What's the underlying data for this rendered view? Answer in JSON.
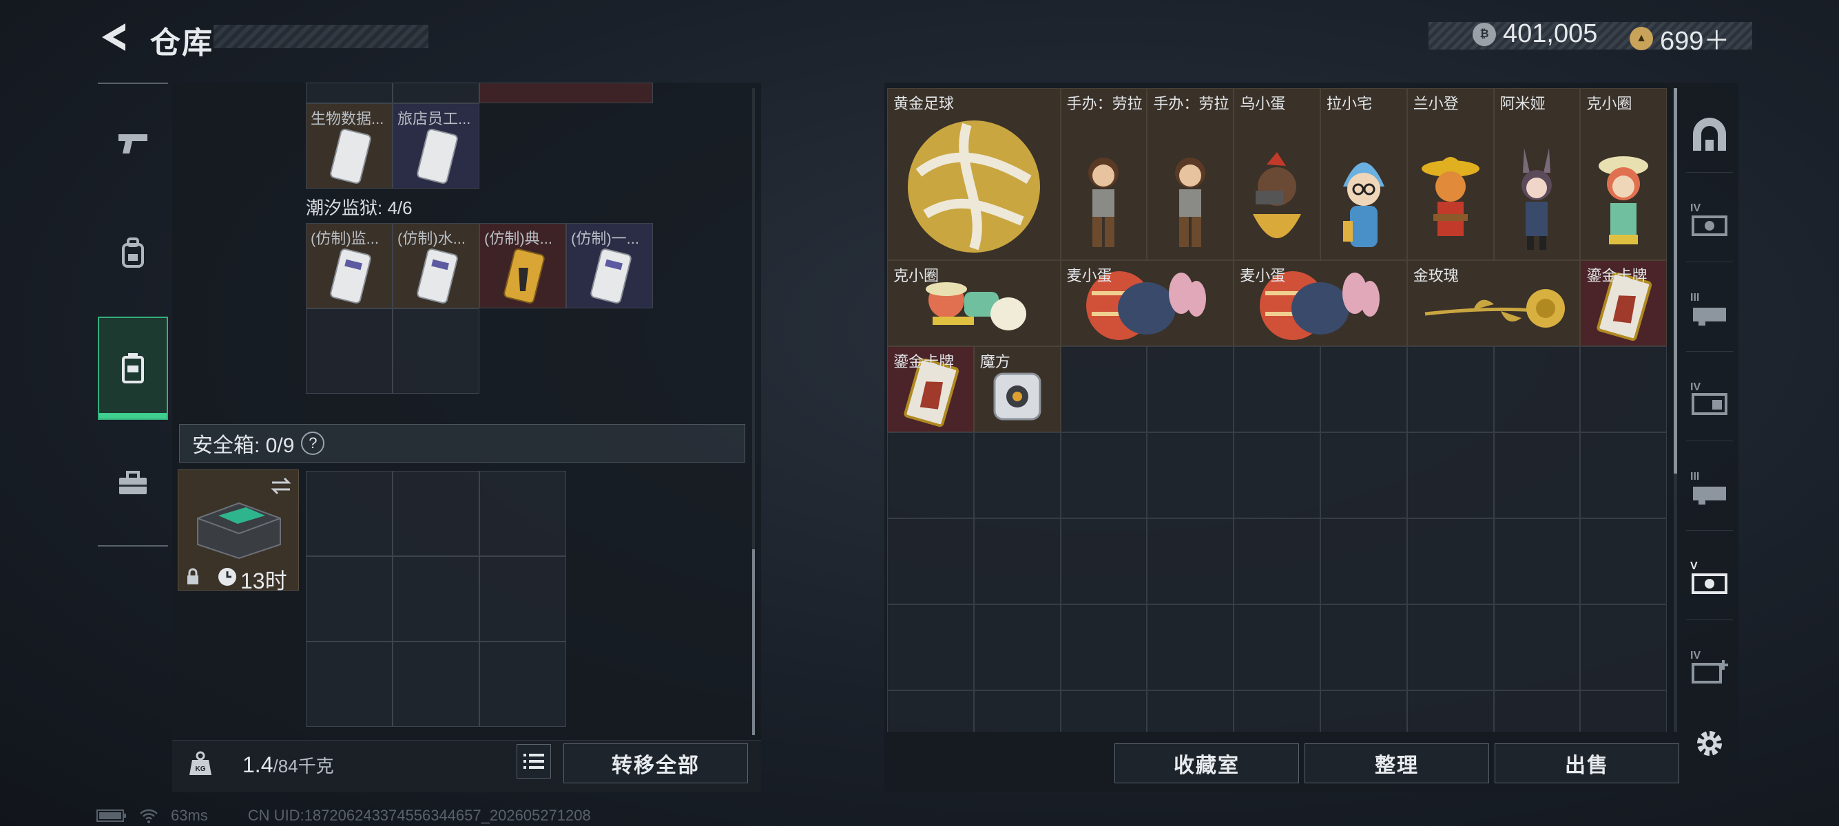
{
  "header": {
    "title": "仓库"
  },
  "currency": [
    {
      "icon": "silver-coin-icon",
      "value": "401,005"
    },
    {
      "icon": "gold-triangle-coin-icon",
      "value": "699＋"
    }
  ],
  "left_nav": [
    {
      "name": "pistol-icon"
    },
    {
      "name": "backpack-icon"
    },
    {
      "name": "chest-rig-icon",
      "active": true
    },
    {
      "name": "toolbox-icon"
    }
  ],
  "left_panel": {
    "items_top": [
      {
        "label": "生物数据...",
        "tag": "brown"
      },
      {
        "label": "旅店员工...",
        "tag": "blue"
      }
    ],
    "section": "潮汐监狱: 4/6",
    "prison_items": [
      {
        "label": "(仿制)监...",
        "tag": "brown"
      },
      {
        "label": "(仿制)水...",
        "tag": "brown"
      },
      {
        "label": "(仿制)典...",
        "tag": "red"
      },
      {
        "label": "(仿制)一...",
        "tag": "blue"
      }
    ],
    "safebox": {
      "label": "安全箱: 0/9",
      "help": "?",
      "timer": "13时"
    }
  },
  "weight": {
    "current": "1.4",
    "max": "/84千克"
  },
  "left_buttons": {
    "transfer_all": "转移全部"
  },
  "storage_items": [
    {
      "label": "黄金足球",
      "kind": "ball"
    },
    {
      "label": "手办：劳拉",
      "kind": "figure-lara"
    },
    {
      "label": "手办：劳拉",
      "kind": "figure-lara"
    },
    {
      "label": "乌小蛋",
      "kind": "figure-egg"
    },
    {
      "label": "拉小宅",
      "kind": "figure-blue"
    },
    {
      "label": "兰小登",
      "kind": "figure-sombrero"
    },
    {
      "label": "阿米娅",
      "kind": "figure-bunny"
    },
    {
      "label": "克小圈",
      "kind": "figure-green"
    },
    {
      "label": "克小圈",
      "kind": "figure-lying"
    },
    {
      "label": "麦小蛋",
      "kind": "egg-bunny"
    },
    {
      "label": "麦小蛋",
      "kind": "egg-bunny"
    },
    {
      "label": "金玫瑰",
      "kind": "rose"
    },
    {
      "label": "鎏金卡牌",
      "kind": "card"
    },
    {
      "label": "鎏金卡牌",
      "kind": "card"
    },
    {
      "label": "魔方",
      "kind": "cube"
    }
  ],
  "bottom_buttons": {
    "collection": "收藏室",
    "sort": "整理",
    "sell": "出售"
  },
  "right_nav": [
    {
      "name": "arch-icon",
      "level": ""
    },
    {
      "name": "storage-upgrade-icon",
      "level": "IV"
    },
    {
      "name": "storage-upgrade-icon",
      "level": "III"
    },
    {
      "name": "storage-upgrade-icon",
      "level": "IV"
    },
    {
      "name": "storage-upgrade-icon",
      "level": "III"
    },
    {
      "name": "storage-upgrade-icon",
      "level": "V"
    },
    {
      "name": "storage-add-icon",
      "level": "IV"
    }
  ],
  "status": {
    "ping": "63ms",
    "uid": "CN UID:187206243374556344657_202605271208"
  }
}
